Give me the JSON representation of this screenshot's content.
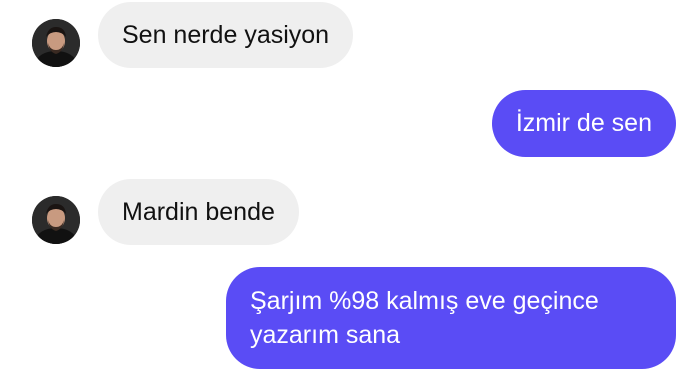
{
  "messages": [
    {
      "direction": "incoming",
      "text": "Sen nerde yasiyon",
      "avatar_icon": "contact-avatar-icon"
    },
    {
      "direction": "outgoing",
      "text": "İzmir de sen"
    },
    {
      "direction": "incoming",
      "text": "Mardin bende",
      "avatar_icon": "contact-avatar-icon"
    },
    {
      "direction": "outgoing",
      "text": "Şarjım %98 kalmış eve geçince yazarım sana"
    }
  ],
  "colors": {
    "incoming_bubble": "#efefef",
    "incoming_text": "#111111",
    "outgoing_bubble": "#5a4cf5",
    "outgoing_text": "#ffffff"
  }
}
